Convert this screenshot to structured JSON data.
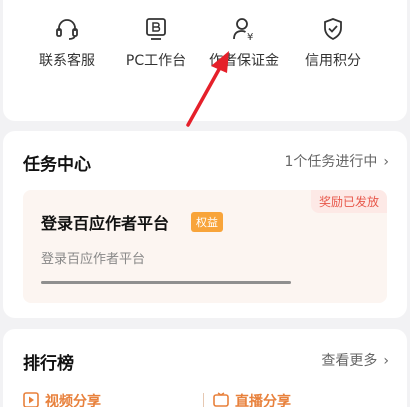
{
  "services": [
    {
      "label": "联系客服",
      "icon": "headset-icon"
    },
    {
      "label": "PC工作台",
      "icon": "pc-workbench-icon"
    },
    {
      "label": "作者保证金",
      "icon": "author-deposit-icon"
    },
    {
      "label": "信用积分",
      "icon": "shield-check-icon"
    }
  ],
  "task_center": {
    "title": "任务中心",
    "progress_text": "1个任务进行中",
    "reward_badge": "奖励已发放",
    "task_name": "登录百应作者平台",
    "task_tag": "权益",
    "task_desc": "登录百应作者平台",
    "progress_fraction": 1.0
  },
  "ranking": {
    "title": "排行榜",
    "more_text": "查看更多",
    "tabs": [
      "视频分享",
      "直播分享"
    ]
  },
  "colors": {
    "accent_orange": "#f8a43a",
    "reward_red": "#e8584b",
    "arrow_red": "#e5202a"
  }
}
